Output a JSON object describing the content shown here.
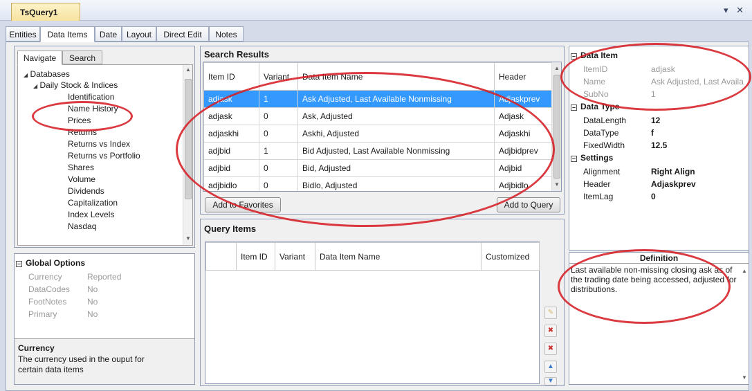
{
  "document": {
    "title": "TsQuery1",
    "window_controls": "▾ ✕"
  },
  "main_tabs": [
    "Entities",
    "Data Items",
    "Date",
    "Layout",
    "Direct Edit",
    "Notes"
  ],
  "navigate": {
    "tabs": [
      "Navigate",
      "Search"
    ],
    "tree": {
      "root": "Databases",
      "group": "Daily Stock & Indices",
      "items": [
        "Identification",
        "Name History",
        "Prices",
        "Returns",
        "Returns vs Index",
        "Returns vs Portfolio",
        "Shares",
        "Volume",
        "Dividends",
        "Capitalization",
        "Index Levels",
        "Nasdaq"
      ]
    }
  },
  "global_options": {
    "title": "Global Options",
    "rows": [
      {
        "key": "Currency",
        "value": "Reported"
      },
      {
        "key": "DataCodes",
        "value": "No"
      },
      {
        "key": "FootNotes",
        "value": "No"
      },
      {
        "key": "Primary",
        "value": "No"
      }
    ],
    "help_title": "Currency",
    "help_text": "The currency used in the ouput for certain data items"
  },
  "search_results": {
    "title": "Search Results",
    "columns": [
      "Item ID",
      "Variant",
      "Data Item Name",
      "Header"
    ],
    "rows": [
      [
        "adjask",
        "1",
        "Ask Adjusted, Last Available Nonmissing",
        "Adjaskprev"
      ],
      [
        "adjask",
        "0",
        "Ask, Adjusted",
        "Adjask"
      ],
      [
        "adjaskhi",
        "0",
        "Askhi, Adjusted",
        "Adjaskhi"
      ],
      [
        "adjbid",
        "1",
        "Bid Adjusted, Last Available Nonmissing",
        "Adjbidprev"
      ],
      [
        "adjbid",
        "0",
        "Bid, Adjusted",
        "Adjbid"
      ],
      [
        "adjbidlo",
        "0",
        "Bidlo, Adjusted",
        "Adjbidlo"
      ]
    ],
    "add_favorites": "Add to Favorites",
    "add_query": "Add to Query"
  },
  "query_items": {
    "title": "Query Items",
    "columns": [
      "Item ID",
      "Variant",
      "Data Item Name",
      "Customized"
    ]
  },
  "properties": {
    "data_item": {
      "title": "Data Item",
      "rows": [
        {
          "key": "ItemID",
          "value": "adjask"
        },
        {
          "key": "Name",
          "value": "Ask Adjusted, Last Availa"
        },
        {
          "key": "SubNo",
          "value": "1"
        }
      ]
    },
    "data_type": {
      "title": "Data Type",
      "rows": [
        {
          "key": "DataLength",
          "value": "12"
        },
        {
          "key": "DataType",
          "value": "f"
        },
        {
          "key": "FixedWidth",
          "value": "12.5"
        }
      ]
    },
    "settings": {
      "title": "Settings",
      "rows": [
        {
          "key": "Alignment",
          "value": "Right Align"
        },
        {
          "key": "Header",
          "value": "Adjaskprev"
        },
        {
          "key": "ItemLag",
          "value": "0"
        }
      ]
    }
  },
  "definition": {
    "title": "Definition",
    "text": "Last available non-missing closing ask as of the trading date being accessed, adjusted for distributions."
  },
  "colors": {
    "selection": "#3399ff",
    "annotation": "#d51f26",
    "doc_tab": "#f7e2a0"
  }
}
